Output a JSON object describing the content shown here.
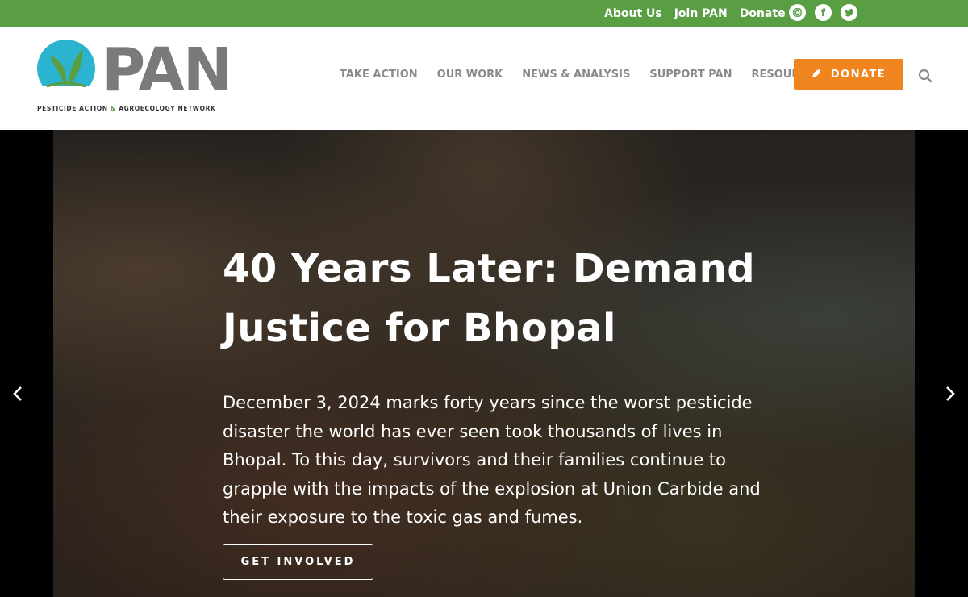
{
  "topbar": {
    "links": [
      "About Us",
      "Join PAN",
      "Donate"
    ],
    "social": [
      "instagram-icon",
      "facebook-icon",
      "twitter-icon"
    ],
    "background": "#5a9e43"
  },
  "header": {
    "logo_text": "PAN",
    "logo_tagline_a": "PESTICIDE ACTION",
    "logo_tagline_amp": "&",
    "logo_tagline_b": "AGROECOLOGY NETWORK",
    "nav": [
      "TAKE ACTION",
      "OUR WORK",
      "NEWS & ANALYSIS",
      "SUPPORT PAN",
      "RESOURCES"
    ],
    "donate_label": "DONATE",
    "donate_color": "#f0851f"
  },
  "hero": {
    "title": "40 Years Later: Demand Justice for Bhopal",
    "text": "December 3, 2024 marks forty years since the worst pesticide disaster the world has ever seen took thousands of lives in Bhopal. To this day, survivors and their families continue to grapple with the impacts of the explosion at Union Carbide and their exposure to the toxic gas and fumes.",
    "cta": "GET INVOLVED",
    "prev_icon": "chevron-left-icon",
    "next_icon": "chevron-right-icon"
  }
}
